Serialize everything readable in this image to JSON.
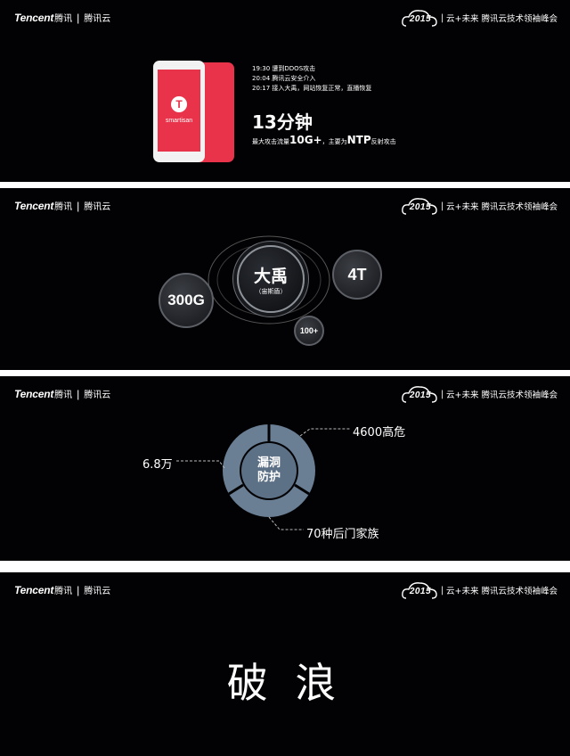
{
  "header": {
    "brand_en": "Tencent",
    "brand_cn": "腾讯",
    "brand_sep": "|",
    "brand_cloud": "腾讯云",
    "year": "2015",
    "summit_sep": "|",
    "summit_text": "云+未来 腾讯云技术领袖峰会"
  },
  "slide1": {
    "phone_brand": "smartisan",
    "phone_logo_letter": "T",
    "timeline": [
      "19:30 遭到DDOS攻击",
      "20:04 腾讯云安全介入",
      "20:17 接入大禹，网站恢复正常，直播恢复"
    ],
    "duration": "13分钟",
    "flow_prefix": "最大攻击流量",
    "flow_value": "10G+",
    "flow_mid": "，主要为",
    "flow_proto": "NTP",
    "flow_suffix": "反射攻击",
    "colors": {
      "phone_red": "#e8334a",
      "phone_white": "#f2f2f2"
    }
  },
  "slide2": {
    "center_title": "大禹",
    "center_sub": "（宙斯盾）",
    "left_bubble": "300G",
    "right_bubble": "4T",
    "small_bubble": "100+"
  },
  "slide3": {
    "center_line1": "漏洞",
    "center_line2": "防护",
    "label_right": "4600高危",
    "label_left": "6.8万",
    "label_bottom": "70种后门家族",
    "colors": {
      "ring": "#6a7e94",
      "core": "#5d7186"
    }
  },
  "slide4": {
    "title": "破 浪"
  }
}
